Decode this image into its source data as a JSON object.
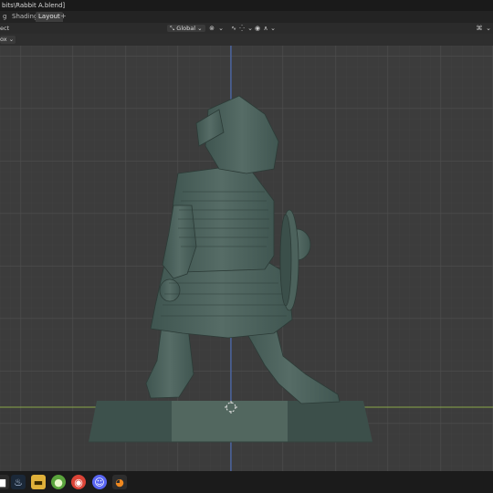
{
  "window": {
    "title": "bits\\Rabbit A.blend]"
  },
  "workspace_tabs": [
    {
      "label": "g"
    },
    {
      "label": "Shading"
    },
    {
      "label": "Layout",
      "active": true
    }
  ],
  "header": {
    "select_label": "ect",
    "orientation": "Global"
  },
  "subheader": {
    "dropdown_label": "ox"
  },
  "colors": {
    "x_axis": "#8aa84a",
    "y_axis": "#4a6fc8",
    "grid_major": "#4c4c4c",
    "grid_minor": "#434343"
  },
  "taskbar": {
    "icons": [
      "windows-icon",
      "steam-icon",
      "file-explorer-icon",
      "green-app-icon",
      "chrome-icon",
      "discord-icon",
      "blender-icon"
    ]
  }
}
